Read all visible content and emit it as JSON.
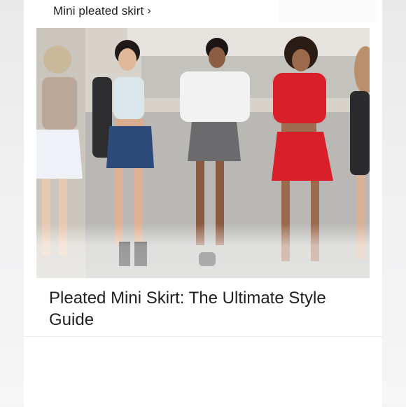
{
  "header": {
    "link_label": "Mini pleated skirt",
    "chevron": "›"
  },
  "image": {
    "alt": "Five women wearing pleated mini skirts"
  },
  "article": {
    "title": "Pleated Mini Skirt: The Ultimate Style Guide"
  },
  "colors": {
    "red_outfit": "#d81f2a",
    "denim": "#2c4a7a",
    "grey_skirt": "#6b6b6e",
    "white_skirt": "#eef1f6"
  }
}
